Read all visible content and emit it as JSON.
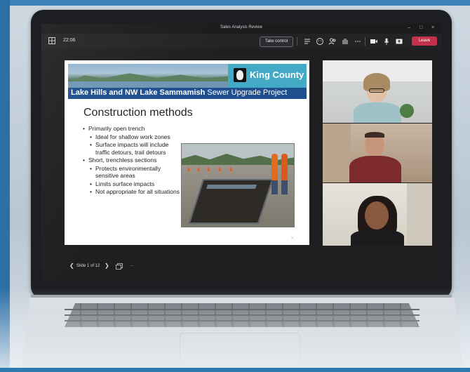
{
  "window": {
    "title": "Sales Analysis Review",
    "minimize": "–",
    "maximize": "□",
    "close": "×"
  },
  "toolbar": {
    "meeting_time": "22:06",
    "take_control_label": "Take control",
    "leave_label": "Leave",
    "icons": [
      "chat-icon",
      "reactions-icon",
      "people-icon",
      "raise-hand-icon",
      "more-icon",
      "camera-icon",
      "mic-icon",
      "share-icon"
    ]
  },
  "slide": {
    "brand": "King County",
    "project_title_bold": "Lake Hills and NW Lake Sammamish",
    "project_title_rest": " Sewer Upgrade Project",
    "heading": "Construction methods",
    "bullets": [
      {
        "text": "Primarily open trench",
        "level": 1
      },
      {
        "text": "Ideal for shallow work zones",
        "level": 2
      },
      {
        "text": "Surface impacts will include traffic detours, trail detours",
        "level": 2
      },
      {
        "text": "Short, trenchless sections",
        "level": 1
      },
      {
        "text": "Protects environmentally sensitive areas",
        "level": 2
      },
      {
        "text": "Limits surface impacts",
        "level": 2
      },
      {
        "text": "Not appropriate for all situations",
        "level": 2
      }
    ],
    "page_number": "11"
  },
  "slide_controls": {
    "prev": "❮",
    "label": "Slide 1 of 12",
    "next": "❯",
    "more": "···"
  },
  "colors": {
    "leave": "#c4314b",
    "banner_blue": "#43a9c4",
    "project_bar": "#1f4f8f",
    "frame": "#2b6fa6"
  }
}
